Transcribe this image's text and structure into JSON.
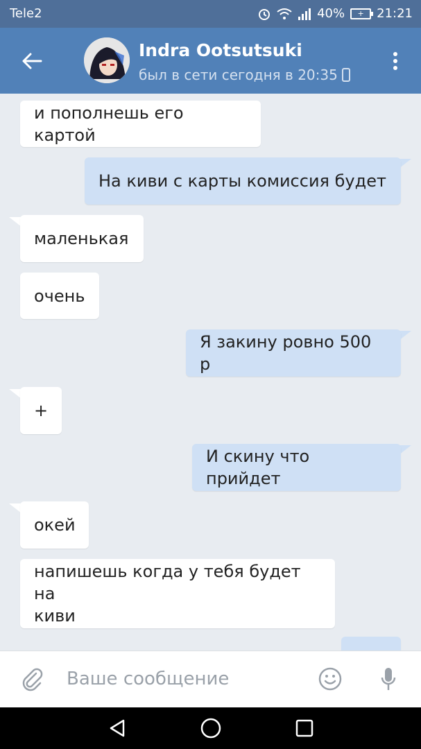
{
  "status": {
    "carrier": "Tele2",
    "battery": "40%",
    "time": "21:21"
  },
  "header": {
    "name": "Indra Ootsutsuki",
    "presence": "был в сети сегодня в 20:35"
  },
  "messages": [
    {
      "dir": "in",
      "text": "и пополнешь его картой"
    },
    {
      "dir": "out",
      "text": "На киви с карты комиссия будет"
    },
    {
      "dir": "in",
      "text": "маленькая"
    },
    {
      "dir": "in",
      "text": "очень"
    },
    {
      "dir": "out",
      "text": "Я закину ровно 500 р"
    },
    {
      "dir": "in",
      "text": "+"
    },
    {
      "dir": "out",
      "text": "И скину что прийдет"
    },
    {
      "dir": "in",
      "text": "окей"
    },
    {
      "dir": "in",
      "text_line1": "напишешь когда у тебя будет на",
      "text_line2": "киви"
    }
  ],
  "composer": {
    "placeholder": "Ваше сообщение"
  },
  "colors": {
    "statusbar": "#4f6f99",
    "appbar": "#5181b8",
    "chat_bg": "#e8ecf1",
    "incoming_bubble": "#ffffff",
    "outgoing_bubble": "#cfe0f5"
  },
  "icons": {
    "back": "arrow-left-icon",
    "menu": "more-vertical-icon",
    "attach": "paperclip-icon",
    "emoji": "smile-icon",
    "voice": "microphone-icon",
    "nav_back": "triangle-back-icon",
    "nav_home": "circle-home-icon",
    "nav_recent": "square-recent-icon"
  }
}
